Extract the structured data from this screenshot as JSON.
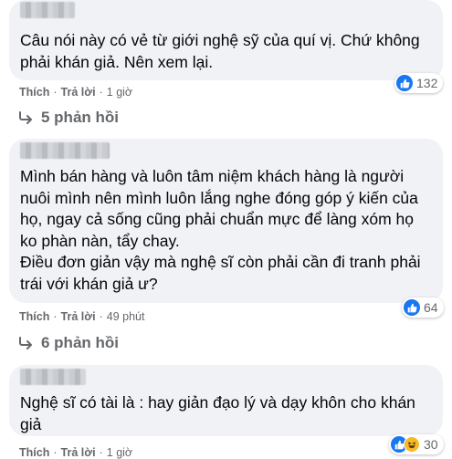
{
  "comments": [
    {
      "text": "Câu nói này có vẻ từ giới nghệ sỹ của quí vị. Chứ không\nphải khán giả. Nên xem lại.",
      "like_label": "Thích",
      "reply_label": "Trả lời",
      "time": "1 giờ",
      "reaction_count": "132",
      "replies_label": "5 phản hồi"
    },
    {
      "text": "Mình bán hàng và luôn tâm niệm khách hàng là người\nnuôi mình nên mình luôn lắng nghe đóng góp ý kiến của\nhọ, ngay cả sống cũng phải chuẩn mực để làng xóm họ\nko phàn nàn, tẩy chay.\nĐiều đơn giản vậy mà nghệ sĩ còn phải cần đi tranh phải\ntrái với khán giả ư?",
      "like_label": "Thích",
      "reply_label": "Trả lời",
      "time": "49 phút",
      "reaction_count": "64",
      "replies_label": "6 phản hồi"
    },
    {
      "text": "Nghệ sĩ có tài là : hay giản đạo lý và dạy khôn cho khán\ngiả",
      "like_label": "Thích",
      "reply_label": "Trả lời",
      "time": "1 giờ",
      "reaction_count": "30"
    }
  ],
  "icons": {
    "like": "like-icon",
    "haha": "haha-icon",
    "reply_arrow": "reply-arrow-icon"
  },
  "colors": {
    "bubble": "#f0f2f5",
    "like_blue": "#1877f2",
    "meta_gray": "#65676b"
  }
}
